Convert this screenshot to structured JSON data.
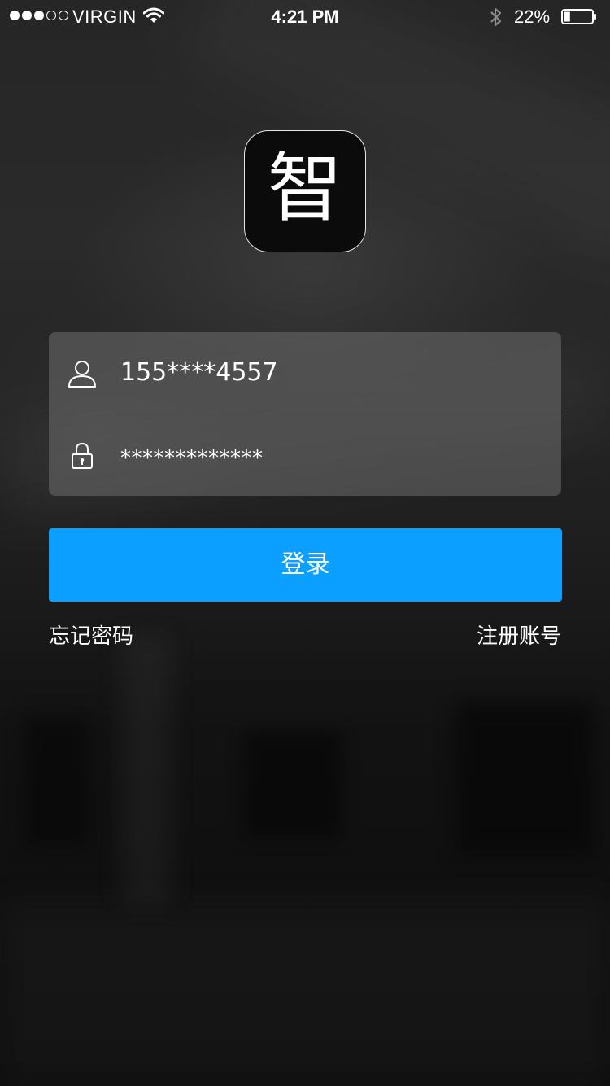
{
  "status_bar": {
    "carrier": "VIRGIN",
    "time": "4:21 PM",
    "battery_percent": "22%",
    "signal_bars_filled": 3,
    "signal_bars_total": 5,
    "battery_level": 0.22
  },
  "logo": {
    "glyph": "智"
  },
  "login_form": {
    "username_value": "155****4557",
    "password_value": "*************",
    "username_icon": "user-icon",
    "password_icon": "lock-icon",
    "submit_label": "登录"
  },
  "links": {
    "forgot_password": "忘记密码",
    "register": "注册账号"
  },
  "colors": {
    "accent": "#0ba0ff",
    "background": "#1a1a1a",
    "text": "#ffffff"
  }
}
